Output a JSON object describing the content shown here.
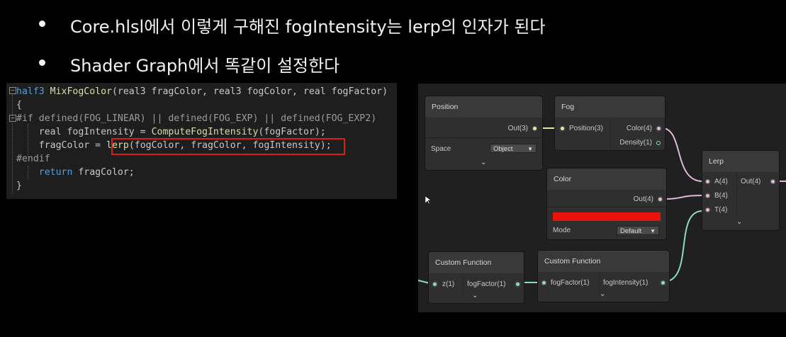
{
  "slide": {
    "bullets": [
      "Core.hlsl에서 이렇게 구해진 fogIntensity는 lerp의 인자가 된다",
      "Shader Graph에서 똑같이 설정한다"
    ]
  },
  "code": {
    "lines": [
      {
        "parts": [
          [
            "kw",
            "half3"
          ],
          [
            "fn",
            " MixFogColor"
          ],
          [
            "id",
            "(real3 fragColor, real3 fogColor, real fogFactor)"
          ]
        ]
      },
      {
        "parts": [
          [
            "id",
            "{"
          ]
        ]
      },
      {
        "parts": [
          [
            "pp",
            "#if defined(FOG_LINEAR) || defined(FOG_EXP) || defined(FOG_EXP2)"
          ]
        ]
      },
      {
        "parts": [
          [
            "id",
            "    real fogIntensity = "
          ],
          [
            "fn",
            "ComputeFogIntensity"
          ],
          [
            "id",
            "(fogFactor);"
          ]
        ]
      },
      {
        "parts": [
          [
            "id",
            "    fragColor = "
          ],
          [
            "fn",
            "lerp"
          ],
          [
            "id",
            "(fogColor, fragColor, fogIntensity);"
          ]
        ]
      },
      {
        "parts": [
          [
            "pp",
            "#endif"
          ]
        ]
      },
      {
        "parts": [
          [
            "id",
            "    "
          ],
          [
            "kw",
            "return"
          ],
          [
            "id",
            " fragColor;"
          ]
        ]
      },
      {
        "parts": [
          [
            "id",
            "}"
          ]
        ]
      }
    ]
  },
  "graph": {
    "position_node": {
      "title": "Position",
      "out": "Out(3)",
      "space_label": "Space",
      "space_value": "Object"
    },
    "fog_node": {
      "title": "Fog",
      "in": "Position(3)",
      "out_color": "Color(4)",
      "out_density": "Density(1)"
    },
    "color_node": {
      "title": "Color",
      "out": "Out(4)",
      "mode_label": "Mode",
      "mode_value": "Default",
      "swatch": "#e8130c"
    },
    "lerp_node": {
      "title": "Lerp",
      "in_a": "A(4)",
      "in_b": "B(4)",
      "in_t": "T(4)",
      "out": "Out(4)"
    },
    "cf1_node": {
      "title": "Custom Function",
      "in": "z(1)",
      "out": "fogFactor(1)"
    },
    "cf2_node": {
      "title": "Custom Function",
      "in": "fogFactor(1)",
      "out": "fogIntensity(1)"
    },
    "colors": {
      "vector3_wire": "#e8e8a0",
      "vector4_wire": "#e0b8d8",
      "float_wire": "#8fd8c8",
      "highlight": "#d91c1c"
    }
  }
}
